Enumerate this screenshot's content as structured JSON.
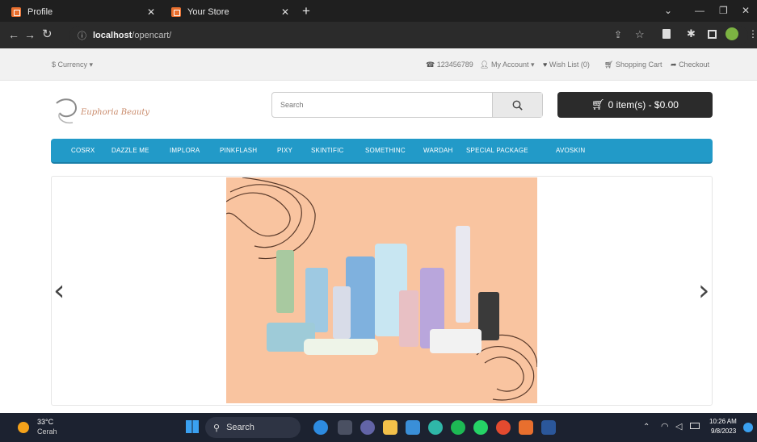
{
  "browser": {
    "tabs": [
      {
        "label": "Profile",
        "active": false
      },
      {
        "label": "Your Store",
        "active": true
      }
    ],
    "new_tab": "+",
    "url_host": "localhost",
    "url_path": "/opencart/",
    "window_controls": [
      "chevron-down-icon",
      "minimize-icon",
      "restore-icon",
      "close-icon"
    ]
  },
  "topbar": {
    "currency": "$ Currency",
    "phone": "123456789",
    "my_account": "My Account",
    "wishlist": "Wish List (0)",
    "shopping_cart": "Shopping Cart",
    "checkout": "Checkout"
  },
  "header": {
    "logo_text": "Euphoria Beauty",
    "search_placeholder": "Search",
    "cart_label": "0 item(s) - $0.00"
  },
  "menu": {
    "items": [
      "COSRX",
      "DAZZLE ME",
      "IMPLORA",
      "PINKFLASH",
      "PIXY",
      "SKINTIFIC",
      "SOMETHINC",
      "WARDAH",
      "SPECIAL PACKAGE",
      "AVOSKIN"
    ]
  },
  "slideshow": {
    "prev": "‹",
    "next": "›",
    "banner_bg": "#f9c4a0"
  },
  "taskbar": {
    "weather_temp": "33°C",
    "weather_desc": "Cerah",
    "search_label": "Search",
    "time": "10:26 AM",
    "date": "9/8/2023"
  },
  "colors": {
    "menu_blue": "#229ac8",
    "cart_dark": "#2b2b2b",
    "chrome_dark": "#1f1f1f"
  }
}
